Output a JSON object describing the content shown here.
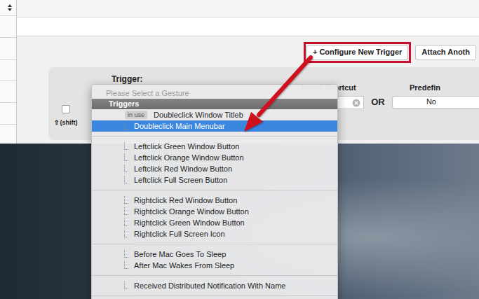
{
  "toolbar": {
    "buttons": [
      {
        "label": "+ Configure New Trigger",
        "highlighted": true
      },
      {
        "label": "Attach Anoth",
        "highlighted": false
      }
    ]
  },
  "trigger_panel": {
    "title": "Trigger:",
    "keyboard_label": "board Shortcut",
    "or": "OR",
    "predefined_label": "Predefin",
    "predefined_value": "No",
    "shift_label": "⇧(shift)",
    "shift_checked": false
  },
  "menu": {
    "placeholder": "Please Select a Gesture",
    "header": "Triggers",
    "groups": [
      [
        {
          "label": "Doubleclick Window Titleb",
          "badge": "in use",
          "selected": false
        },
        {
          "label": "Doubleclick Main Menubar",
          "selected": true
        }
      ],
      [
        {
          "label": "Leftclick Green Window Button",
          "selected": false
        },
        {
          "label": "Leftclick Orange Window Button",
          "selected": false
        },
        {
          "label": "Leftclick Red Window Button",
          "selected": false
        },
        {
          "label": "Leftclick Full Screen Button",
          "selected": false
        }
      ],
      [
        {
          "label": "Rightclick Red Window Button",
          "selected": false
        },
        {
          "label": "Rightclick Orange Window Button",
          "selected": false
        },
        {
          "label": "Rightclick Green Window Button",
          "selected": false
        },
        {
          "label": "Rightclick Full Screen Icon",
          "selected": false
        }
      ],
      [
        {
          "label": "Before Mac Goes To Sleep",
          "selected": false
        },
        {
          "label": "After Mac Wakes From Sleep",
          "selected": false
        }
      ],
      [
        {
          "label": "Received Distributed Notification With Name",
          "selected": false
        }
      ]
    ]
  }
}
